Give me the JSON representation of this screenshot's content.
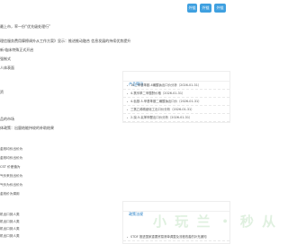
{
  "header": {
    "buttons": [
      {
        "label": "外链"
      },
      {
        "label": "外链"
      },
      {
        "label": "外链"
      }
    ]
  },
  "sidebar": {
    "panel1": {
      "title": "产品简讯",
      "items": [
        {
          "text": "14二甲基苯胺-4磺酸钠出口价分析（2026-01-31）"
        },
        {
          "text": "4-氯邻苯二甲酸酐价格（2026-01-31）"
        },
        {
          "text": "4-氨基-3-甲基苯胺二磺酸钠出口价（2026-01-31）"
        },
        {
          "text": "三氯乙烯精细化工出口价分析（2026-01-31）"
        },
        {
          "text": "2-溴-5-氟苯甲醛出口价分析（2026-01-31）"
        }
      ]
    },
    "panel2": {
      "title": "政策法规",
      "items": [
        {
          "text": "STDF 推进国家重要贸易清单调整及流程改善的补充通知"
        },
        {
          "text": "STDF 推进国家重要贸易清单调整及流程改善措施"
        }
      ]
    }
  },
  "main": {
    "lines": [
      {
        "text": "最上市，率一份“优先级处理行”"
      },
      {
        "text": "理信服务费用摩擦调外从工作方案》显示：推进推动融合 信息发展的持续优势提升"
      },
      {
        "text": "新·临床特殊正式开启"
      },
      {
        "text": "强制式"
      },
      {
        "text": "人体表面"
      },
      {
        "text": "资"
      },
      {
        "text": "品的市场"
      },
      {
        "text": "体政策：出量结能持较的补助结果"
      }
    ],
    "left_rows": [
      {
        "text": "金效均价出价为"
      },
      {
        "text": "金效均价出价为"
      },
      {
        "text": "CST 价差值为"
      },
      {
        "text": "气价来处出价为"
      },
      {
        "text": "气价为价出价为"
      },
      {
        "text": "金效价为调用"
      }
    ],
    "left_rows2": [
      {
        "text": "机出口到人类"
      },
      {
        "text": "机出口到人类"
      },
      {
        "text": "机出口到人类"
      },
      {
        "text": "机出口到人类"
      },
      {
        "text": "机出口到人类"
      },
      {
        "text": "机出口到人类"
      }
    ]
  },
  "watermark": {
    "text": "小 玩 兰 ・ 秒 从"
  }
}
